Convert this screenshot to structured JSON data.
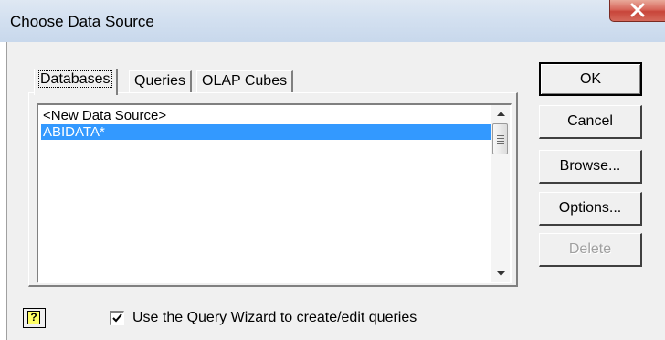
{
  "window": {
    "title": "Choose Data Source",
    "close_icon": "close-x-icon"
  },
  "tabs": [
    {
      "label": "Databases",
      "active": true
    },
    {
      "label": "Queries",
      "active": false
    },
    {
      "label": "OLAP Cubes",
      "active": false
    }
  ],
  "list": {
    "items": [
      {
        "label": "<New Data Source>",
        "selected": false
      },
      {
        "label": "ABIDATA*",
        "selected": true
      }
    ]
  },
  "buttons": {
    "ok": "OK",
    "cancel": "Cancel",
    "browse": "Browse...",
    "options": "Options...",
    "delete": "Delete"
  },
  "footer": {
    "help_icon_text": "?",
    "query_wizard_label": "Use the Query Wizard to create/edit queries",
    "query_wizard_checked": true
  },
  "colors": {
    "selection": "#3399ff",
    "dialog_bg": "#f0f0f0",
    "close_button": "#c8453a"
  }
}
